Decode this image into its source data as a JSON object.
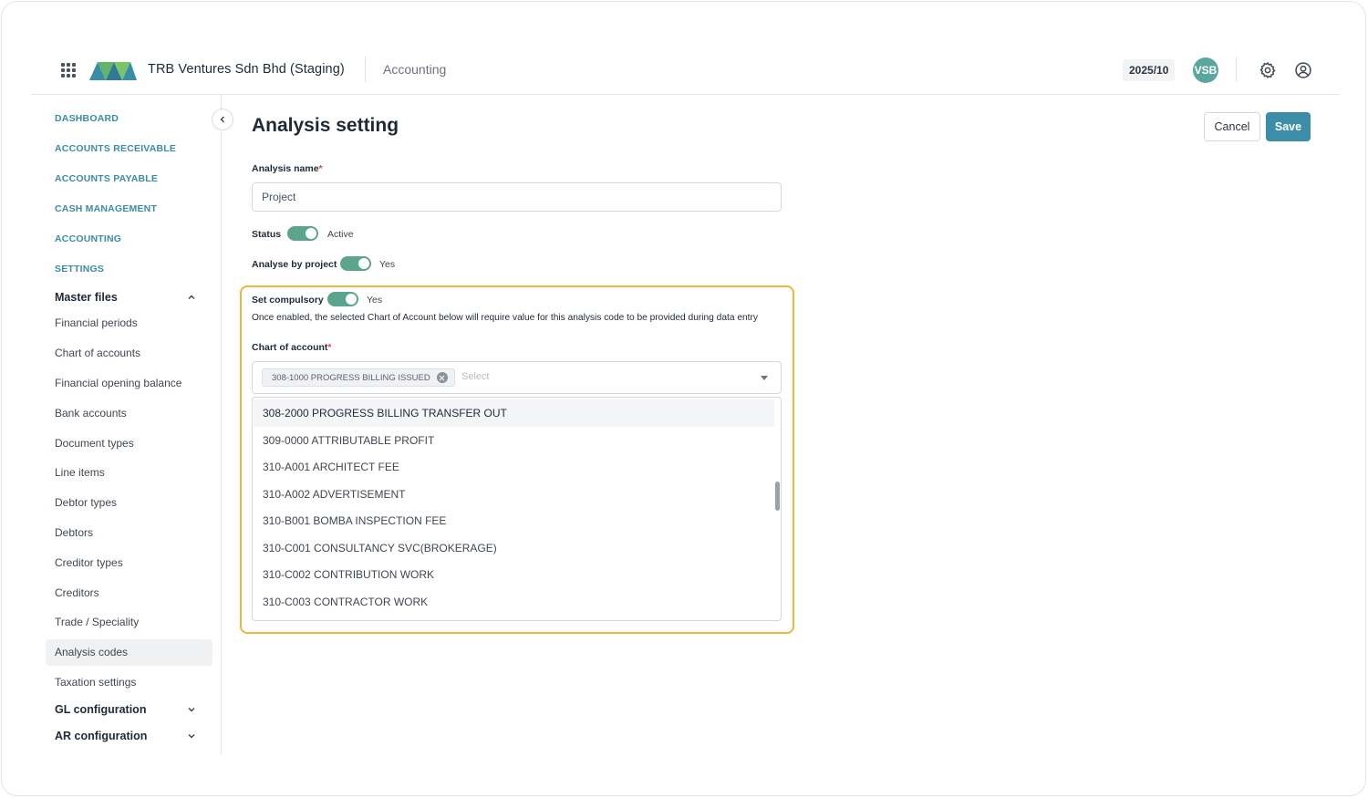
{
  "header": {
    "company": "TRB Ventures Sdn Bhd (Staging)",
    "module": "Accounting",
    "period": "2025/10",
    "avatar_initials": "VSB",
    "icons": {
      "apps": "grid-icon",
      "settings": "gear-icon",
      "account": "user-circle-icon"
    }
  },
  "sidebar": {
    "top_links": [
      "DASHBOARD",
      "ACCOUNTS RECEIVABLE",
      "ACCOUNTS PAYABLE",
      "CASH MANAGEMENT",
      "ACCOUNTING",
      "SETTINGS"
    ],
    "master_files": {
      "label": "Master files",
      "items": [
        "Financial periods",
        "Chart of accounts",
        "Financial opening balance",
        "Bank accounts",
        "Document types",
        "Line items",
        "Debtor types",
        "Debtors",
        "Creditor types",
        "Creditors",
        "Trade / Speciality",
        "Analysis codes",
        "Taxation settings"
      ],
      "active": "Analysis codes"
    },
    "gl_configuration": "GL configuration",
    "ar_configuration": "AR configuration"
  },
  "page": {
    "title": "Analysis setting",
    "cancel_label": "Cancel",
    "save_label": "Save"
  },
  "form": {
    "analysis_name_label": "Analysis name",
    "required_mark": "*",
    "analysis_name_value": "Project",
    "status_label": "Status",
    "status_value": "Active",
    "analyse_by_project_label": "Analyse by project",
    "analyse_by_project_value": "Yes",
    "set_compulsory_label": "Set compulsory",
    "set_compulsory_value": "Yes",
    "compulsory_hint": "Once enabled, the selected Chart of Account below will require value for this analysis code to be provided during data entry",
    "chart_of_account_label": "Chart of account",
    "selected_tag": "308-1000 PROGRESS BILLING ISSUED",
    "select_placeholder": "Select",
    "options": [
      "308-2000 PROGRESS BILLING TRANSFER OUT",
      "309-0000 ATTRIBUTABLE PROFIT",
      "310-A001 ARCHITECT FEE",
      "310-A002 ADVERTISEMENT",
      "310-B001 BOMBA INSPECTION FEE",
      "310-C001 CONSULTANCY SVC(BROKERAGE)",
      "310-C002 CONTRIBUTION WORK",
      "310-C003 CONTRACTOR WORK"
    ],
    "highlight_color": "#f4b43c",
    "accent_color": "#3c8ea8",
    "toggle_color": "#5ba58f"
  }
}
